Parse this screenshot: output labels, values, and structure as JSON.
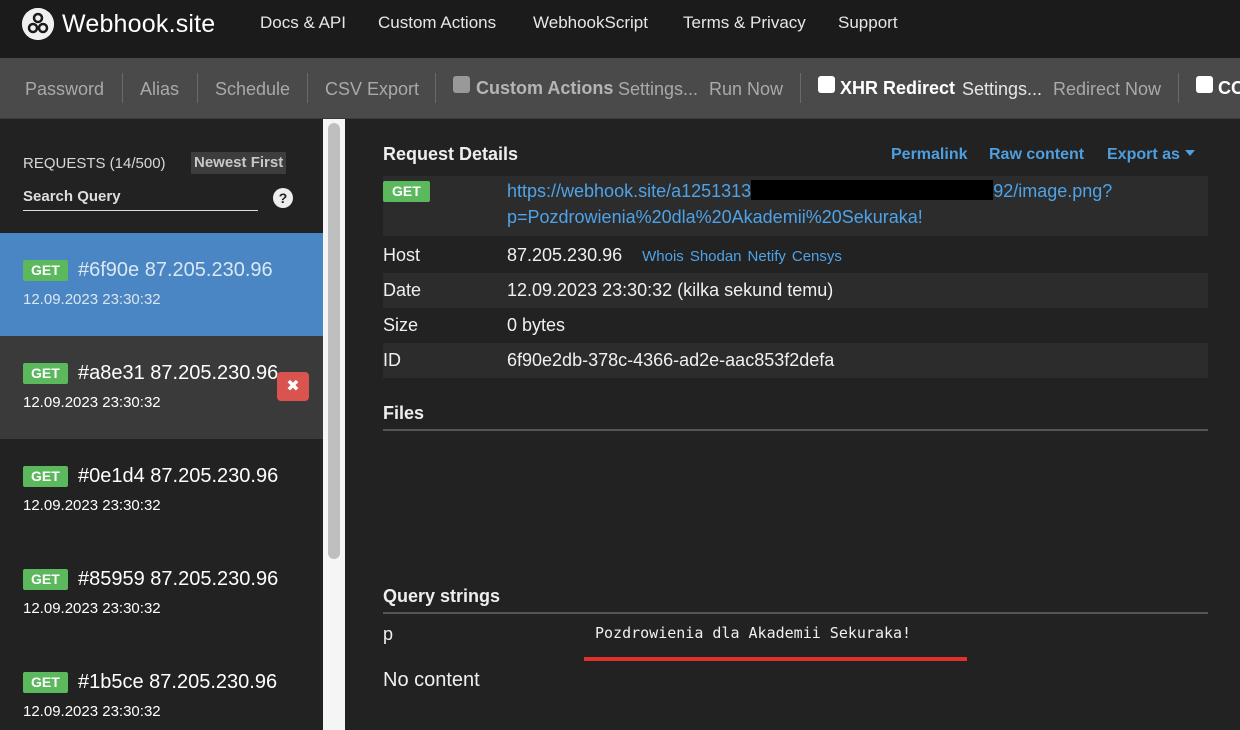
{
  "nav": {
    "brand": "Webhook.site",
    "links": [
      "Docs & API",
      "Custom Actions",
      "WebhookScript",
      "Terms & Privacy",
      "Support"
    ]
  },
  "toolbar": {
    "password": "Password",
    "alias": "Alias",
    "schedule": "Schedule",
    "csv_export": "CSV Export",
    "custom_actions": "Custom Actions",
    "custom_settings": "Settings...",
    "run_now": "Run Now",
    "xhr_redirect": "XHR Redirect",
    "xhr_settings": "Settings...",
    "redirect_now": "Redirect Now",
    "cors_partial": "CO"
  },
  "sidebar": {
    "header": "REQUESTS (14/500)",
    "sort": "Newest First",
    "search_placeholder": "Search Query",
    "help": "?",
    "requests": [
      {
        "method": "GET",
        "title": "#6f90e 87.205.230.96",
        "time": "12.09.2023 23:30:32"
      },
      {
        "method": "GET",
        "title": "#a8e31 87.205.230.96",
        "time": "12.09.2023 23:30:32"
      },
      {
        "method": "GET",
        "title": "#0e1d4 87.205.230.96",
        "time": "12.09.2023 23:30:32"
      },
      {
        "method": "GET",
        "title": "#85959 87.205.230.96",
        "time": "12.09.2023 23:30:32"
      },
      {
        "method": "GET",
        "title": "#1b5ce 87.205.230.96",
        "time": "12.09.2023 23:30:32"
      }
    ],
    "delete_glyph": "✖"
  },
  "details": {
    "title": "Request Details",
    "permalink": "Permalink",
    "raw_content": "Raw content",
    "export_as": "Export as",
    "method": "GET",
    "url_start": "https://webhook.site/a1251313",
    "url_end": "92/image.png?p=Pozdrowienia%20dla%20Akademii%20Sekuraka!",
    "host_label": "Host",
    "host_value": "87.205.230.96",
    "lookups": [
      "Whois",
      "Shodan",
      "Netify",
      "Censys"
    ],
    "date_label": "Date",
    "date_value": "12.09.2023 23:30:32 (kilka sekund temu)",
    "size_label": "Size",
    "size_value": "0 bytes",
    "id_label": "ID",
    "id_value": "6f90e2db-378c-4366-ad2e-aac853f2defa"
  },
  "files": {
    "title": "Files"
  },
  "query": {
    "title": "Query strings",
    "key": "p",
    "value": "Pozdrowienia dla Akademii Sekuraka!",
    "no_content": "No content"
  }
}
